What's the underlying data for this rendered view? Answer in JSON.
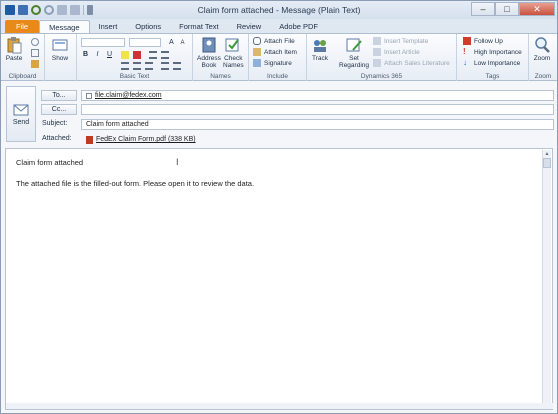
{
  "window": {
    "title": "Claim form attached  -  Message (Plain Text)",
    "controls": {
      "minimize": "–",
      "maximize": "□",
      "close": "✕"
    }
  },
  "tabs": [
    "File",
    "Message",
    "Insert",
    "Options",
    "Format Text",
    "Review",
    "Adobe PDF"
  ],
  "ribbon": {
    "clipboard": {
      "paste": "Paste",
      "label": "Clipboard"
    },
    "show": {
      "show": "Show",
      "label": ""
    },
    "basic_text": {
      "label": "Basic Text",
      "bold": "B",
      "italic": "I",
      "underline": "U",
      "grow": "A",
      "shrink": "A"
    },
    "names": {
      "address_book": "Address\nBook",
      "check_names": "Check\nNames",
      "label": "Names"
    },
    "include": {
      "attach_file": "Attach File",
      "attach_item": "Attach Item",
      "signature": "Signature",
      "label": "Include"
    },
    "dynamics": {
      "track": "Track",
      "set_regarding": "Set\nRegarding",
      "insert_template": "Insert Template",
      "insert_article": "Insert Article",
      "attach_sales": "Attach Sales Literature",
      "label": "Dynamics 365"
    },
    "tags": {
      "follow_up": "Follow Up",
      "high": "High Importance",
      "low": "Low Importance",
      "label": "Tags"
    },
    "zoom": {
      "zoom": "Zoom",
      "label": "Zoom"
    }
  },
  "header": {
    "send": "Send",
    "to_button": "To...",
    "cc_button": "Cc...",
    "to_value": "file.claim@fedex.com",
    "cc_value": "",
    "subject_label": "Subject:",
    "subject_value": "Claim form attached",
    "attached_label": "Attached:",
    "attachment": "FedEx Claim Form.pdf (338 KB)"
  },
  "body": {
    "line1": "Claim form attached",
    "line2": "The attached file is the filled-out form. Please open it to review the data."
  },
  "colors": {
    "file_tab": "#e88a1a",
    "accent": "#2b579a"
  }
}
